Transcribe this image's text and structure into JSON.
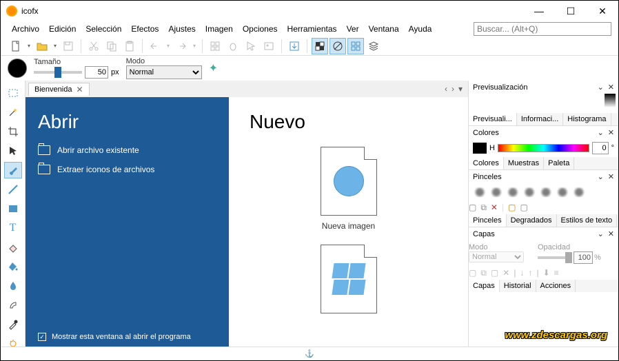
{
  "app": {
    "title": "icofx"
  },
  "menu": [
    "Archivo",
    "Edición",
    "Selección",
    "Efectos",
    "Ajustes",
    "Imagen",
    "Opciones",
    "Herramientas",
    "Ver",
    "Ventana",
    "Ayuda"
  ],
  "search": {
    "placeholder": "Buscar... (Alt+Q)"
  },
  "brush": {
    "size_label": "Tamaño",
    "size_value": "50",
    "size_unit": "px",
    "mode_label": "Modo",
    "mode_value": "Normal"
  },
  "tab": {
    "title": "Bienvenida"
  },
  "welcome": {
    "open_title": "Abrir",
    "open_existing": "Abrir archivo existente",
    "extract_icons": "Extraer iconos de archivos",
    "show_on_start": "Mostrar esta ventana al abrir el programa",
    "new_title": "Nuevo",
    "new_image": "Nueva imagen"
  },
  "panels": {
    "preview": {
      "title": "Previsualización",
      "tabs": [
        "Previsuali...",
        "Informaci...",
        "Histograma"
      ]
    },
    "colors": {
      "title": "Colores",
      "hue_label": "H",
      "hue_value": "0",
      "hue_unit": "°",
      "tabs": [
        "Colores",
        "Muestras",
        "Paleta"
      ]
    },
    "brushes": {
      "title": "Pinceles",
      "tabs": [
        "Pinceles",
        "Degradados",
        "Estilos de texto"
      ]
    },
    "layers": {
      "title": "Capas",
      "mode_label": "Modo",
      "mode_value": "Normal",
      "opacity_label": "Opacidad",
      "opacity_value": "100",
      "opacity_unit": "%",
      "tabs": [
        "Capas",
        "Historial",
        "Acciones"
      ]
    }
  },
  "watermark": "www.zdescargas.org"
}
